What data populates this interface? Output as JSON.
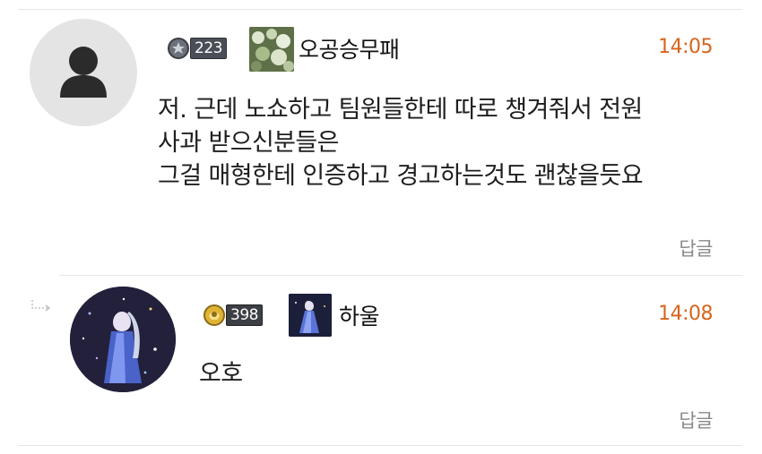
{
  "comments": [
    {
      "level": "223",
      "nickname": "오공승무패",
      "time": "14:05",
      "lines": [
        "저. 근데 노쇼하고 팀원들한테 따로 챙겨줘서 전원",
        "사과 받으신분들은",
        "그걸 매형한테 인증하고 경고하는것도 괜찮을듯요"
      ],
      "reply_label": "답글",
      "avatar_icon": "user-icon",
      "colors": {
        "time": "#d8641c",
        "avatar_bg": "#e4e4e4"
      }
    },
    {
      "level": "398",
      "nickname": "하울",
      "time": "14:08",
      "text": "오호",
      "reply_label": "답글",
      "avatar_icon": "anime-avatar",
      "colors": {
        "time": "#d8641c",
        "avatar_bg": "#23213a"
      }
    }
  ]
}
